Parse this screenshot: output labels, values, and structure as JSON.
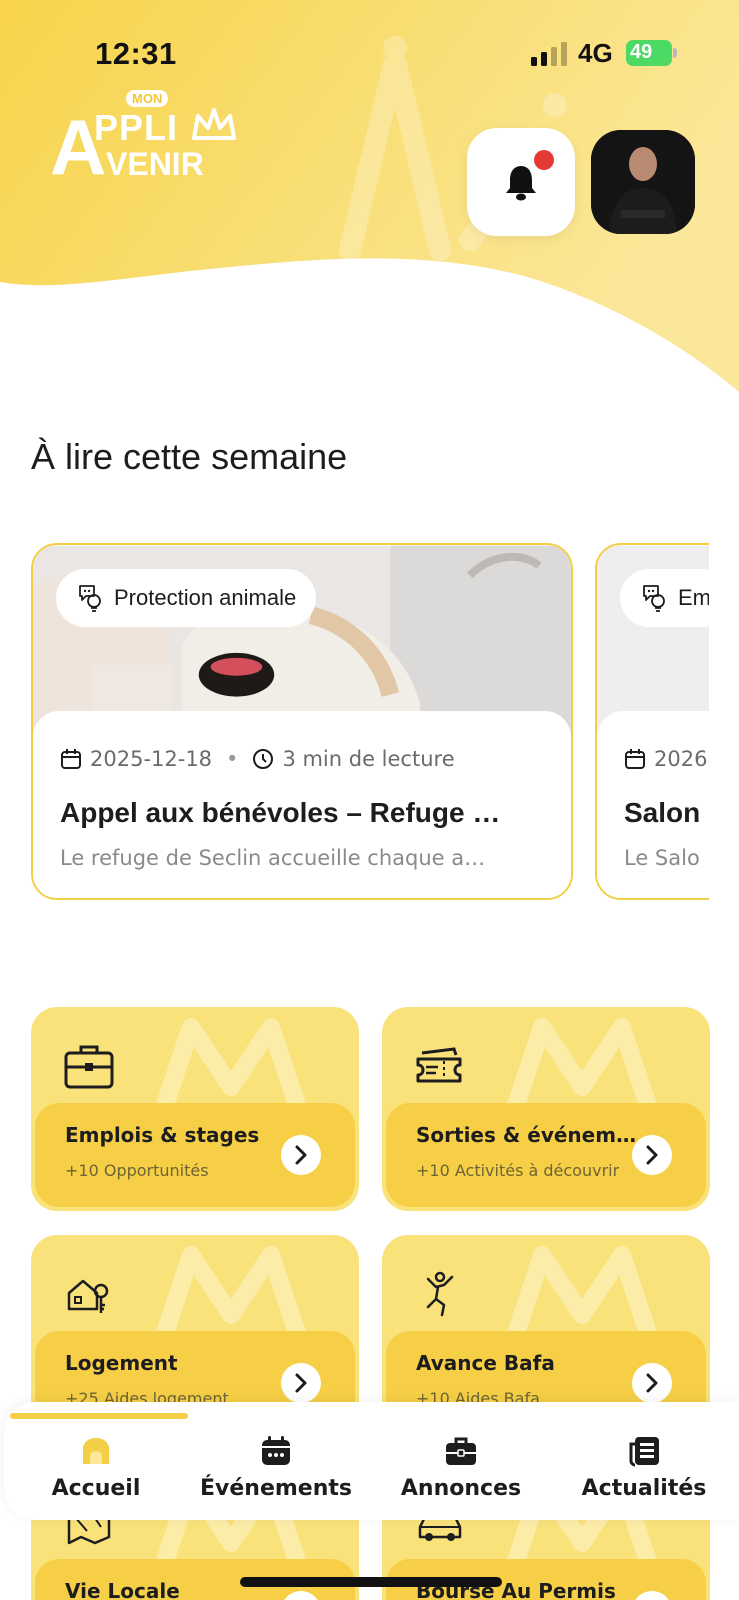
{
  "status_bar": {
    "time": "12:31",
    "network": "4G",
    "battery": "49"
  },
  "logo": {
    "mon": "MON",
    "a": "A",
    "appli": "PPLI",
    "venir": "VENIR"
  },
  "header": {
    "notification_icon": "bell-icon",
    "has_notification": true
  },
  "section": {
    "title": "À lire cette semaine"
  },
  "articles": [
    {
      "tag": "Protection animale",
      "date": "2025-12-18",
      "read_time": "3 min de lecture",
      "title": "Appel aux bénévoles – Refuge …",
      "excerpt": "Le refuge de Seclin accueille chaque a…"
    },
    {
      "tag": "Em",
      "date": "2026",
      "title": "Salon",
      "excerpt": "Le Salo"
    }
  ],
  "categories": [
    {
      "title": "Emplois & stages",
      "subtitle": "+10 Opportunités",
      "icon": "briefcase-icon"
    },
    {
      "title": "Sorties & événem…",
      "subtitle": "+10 Activités à découvrir",
      "icon": "ticket-icon"
    },
    {
      "title": "Logement",
      "subtitle": "+25 Aides logement",
      "icon": "house-key-icon"
    },
    {
      "title": "Avance Bafa",
      "subtitle": "+10 Aides Bafa",
      "icon": "person-jump-icon"
    },
    {
      "title": "Vie Locale",
      "subtitle": "",
      "icon": "map-icon"
    },
    {
      "title": "Bourse Au Permis",
      "subtitle": "",
      "icon": "car-icon"
    }
  ],
  "nav": {
    "items": [
      {
        "label": "Accueil",
        "icon": "home-icon",
        "active": true
      },
      {
        "label": "Événements",
        "icon": "calendar-icon",
        "active": false
      },
      {
        "label": "Annonces",
        "icon": "briefcase-icon",
        "active": false
      },
      {
        "label": "Actualités",
        "icon": "newspaper-icon",
        "active": false
      }
    ]
  },
  "colors": {
    "accent": "#f3cf45",
    "tile": "#f9e27a",
    "tile_panel": "#f6cf46",
    "notification": "#e53935"
  }
}
